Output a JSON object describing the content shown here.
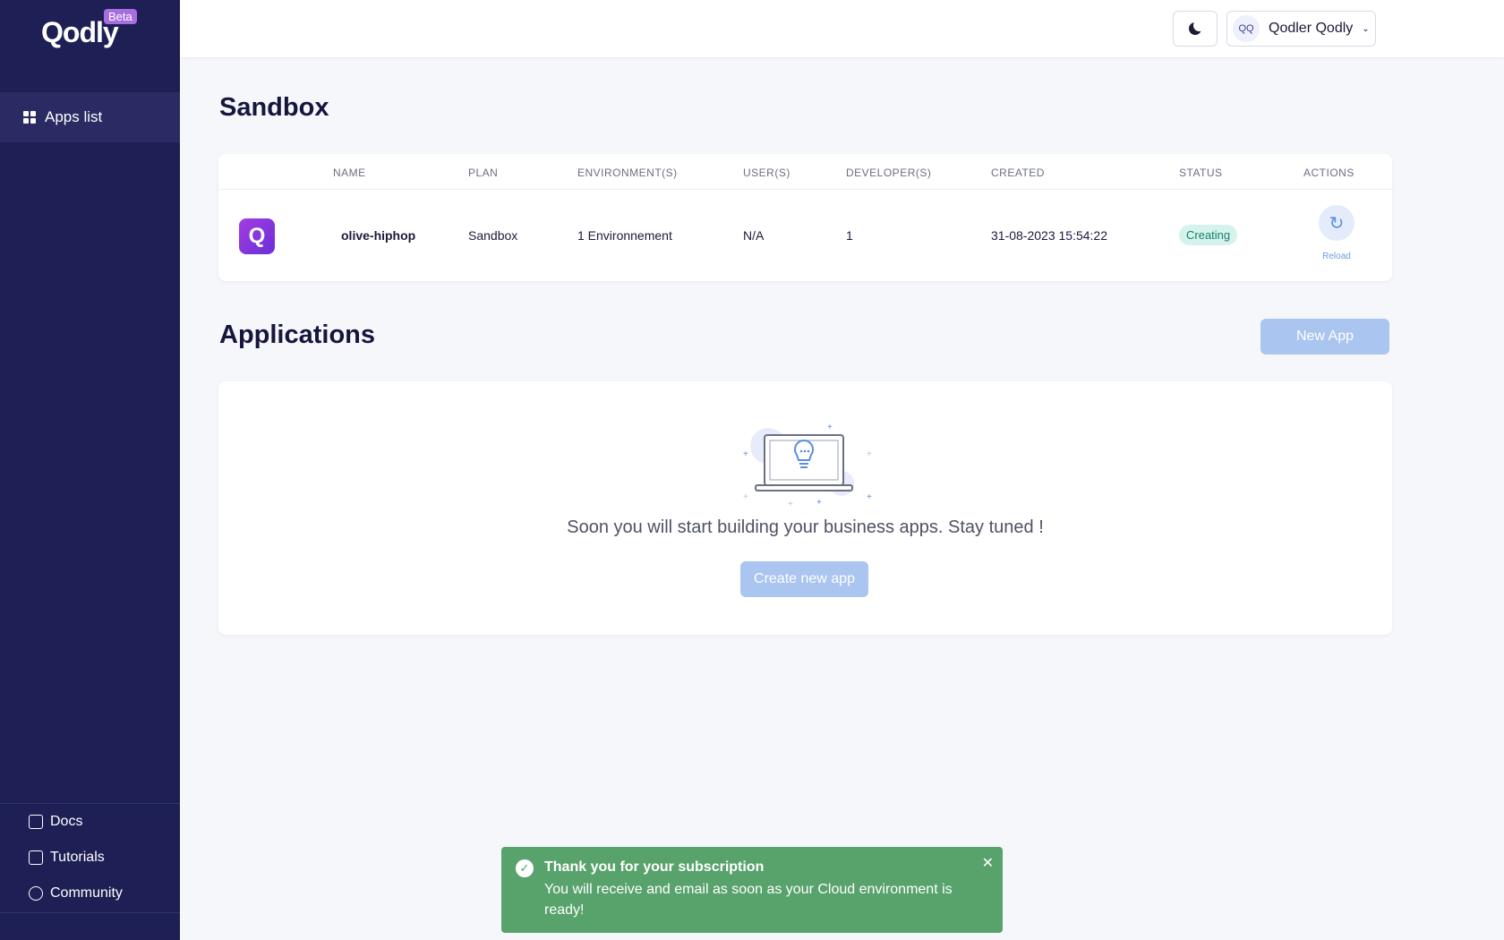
{
  "sidebar": {
    "logo_text": "Qodly",
    "logo_badge": "Beta",
    "nav": [
      {
        "label": "Apps list",
        "icon": "grid-icon",
        "active": true
      }
    ],
    "bottom_links": [
      {
        "label": "Docs",
        "icon": "book-icon"
      },
      {
        "label": "Tutorials",
        "icon": "video-icon"
      },
      {
        "label": "Community",
        "icon": "chat-icon"
      }
    ]
  },
  "topbar": {
    "theme_icon": "moon-icon",
    "user": {
      "initials": "QQ",
      "name": "Qodler Qodly"
    }
  },
  "sandbox": {
    "title": "Sandbox",
    "columns": [
      "NAME",
      "PLAN",
      "ENVIRONMENT(S)",
      "USER(S)",
      "DEVELOPER(S)",
      "CREATED",
      "STATUS",
      "ACTIONS"
    ],
    "row": {
      "icon_letter": "Q",
      "name": "olive-hiphop",
      "plan": "Sandbox",
      "environments": "1 Environnement",
      "users": "N/A",
      "developers": "1",
      "created": "31-08-2023 15:54:22",
      "status": "Creating",
      "action_label": "Reload"
    }
  },
  "applications": {
    "title": "Applications",
    "new_app_label": "New App",
    "empty_text": "Soon you will start building your business apps. Stay tuned !",
    "create_label": "Create new app"
  },
  "toast": {
    "title": "Thank you for your subscription",
    "message": "You will receive and email as soon as your Cloud environment is ready!"
  },
  "colors": {
    "sidebar_bg": "#1e1f55",
    "accent": "#aac5ef",
    "success": "#58a26c",
    "status_bg": "#d5f3ec"
  }
}
